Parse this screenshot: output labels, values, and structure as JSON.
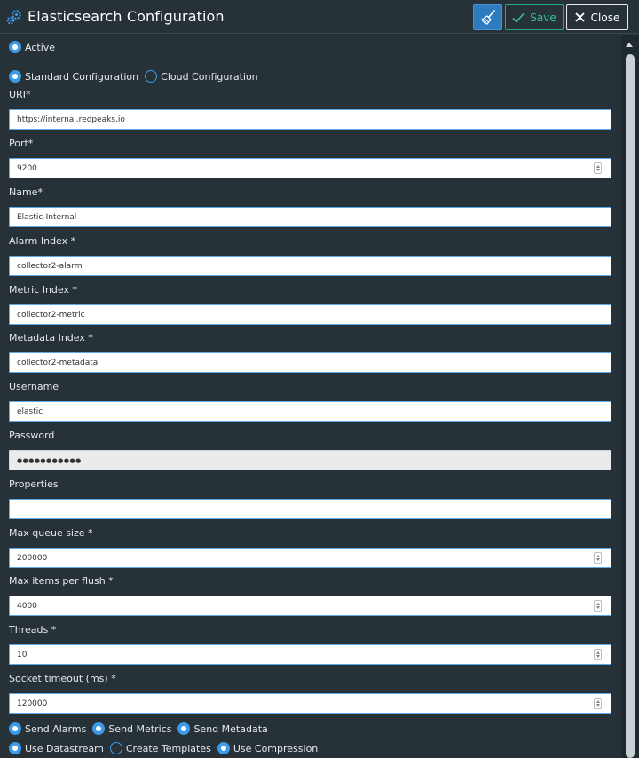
{
  "header": {
    "title": "Elasticsearch Configuration",
    "save_label": "Save",
    "close_label": "Close"
  },
  "active": {
    "label": "Active",
    "checked": true
  },
  "config_type": {
    "options": [
      {
        "label": "Standard Configuration",
        "checked": true
      },
      {
        "label": "Cloud Configuration",
        "checked": false
      }
    ]
  },
  "fields": {
    "uri": {
      "label": "URI*",
      "value": "https://internal.redpeaks.io"
    },
    "port": {
      "label": "Port*",
      "value": "9200"
    },
    "name": {
      "label": "Name*",
      "value": "Elastic-Internal"
    },
    "alarm_index": {
      "label": "Alarm Index *",
      "value": "collector2-alarm"
    },
    "metric_index": {
      "label": "Metric Index *",
      "value": "collector2-metric"
    },
    "metadata_index": {
      "label": "Metadata Index *",
      "value": "collector2-metadata"
    },
    "username": {
      "label": "Username",
      "value": "elastic"
    },
    "password": {
      "label": "Password",
      "value": "●●●●●●●●●●●"
    },
    "properties": {
      "label": "Properties",
      "value": ""
    },
    "max_queue_size": {
      "label": "Max queue size *",
      "value": "200000"
    },
    "max_items_per_flush": {
      "label": "Max items per flush *",
      "value": "4000"
    },
    "threads": {
      "label": "Threads *",
      "value": "10"
    },
    "socket_timeout": {
      "label": "Socket timeout (ms) *",
      "value": "120000"
    }
  },
  "send_options": [
    {
      "label": "Send Alarms",
      "checked": true
    },
    {
      "label": "Send Metrics",
      "checked": true
    },
    {
      "label": "Send Metadata",
      "checked": true
    }
  ],
  "stream_options": [
    {
      "label": "Use Datastream",
      "checked": true
    },
    {
      "label": "Create Templates",
      "checked": false
    },
    {
      "label": "Use Compression",
      "checked": true
    }
  ],
  "colors": {
    "background": "#263238",
    "accent": "#3d9be9",
    "save": "#2ec98d"
  }
}
